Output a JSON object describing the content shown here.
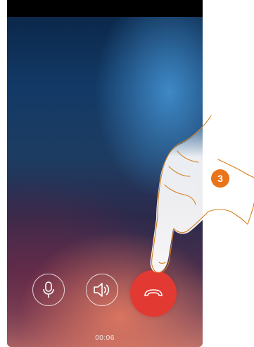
{
  "call": {
    "timer": "00:06"
  },
  "controls": {
    "mic_icon": "microphone-icon",
    "speaker_icon": "speaker-icon",
    "end_call_icon": "hang-up-icon"
  },
  "annotation": {
    "step_number": "3"
  },
  "colors": {
    "end_call": "#e23a32",
    "step_badge": "#e8741c",
    "hand_outline": "#d4801f"
  }
}
